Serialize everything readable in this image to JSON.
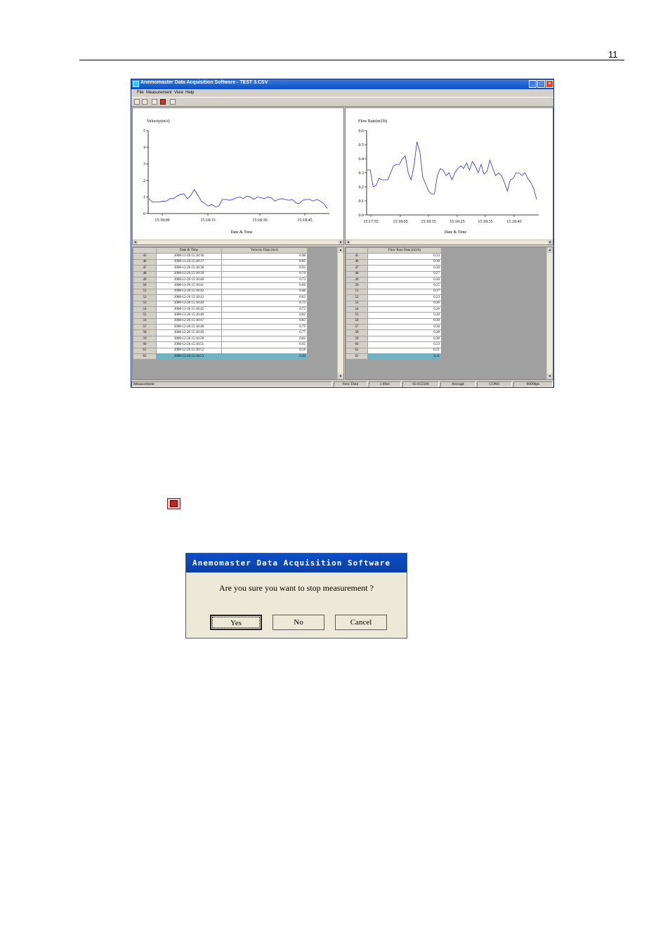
{
  "page": {
    "number": "11"
  },
  "window": {
    "title": "Anemomaster Data Acquisition Software - TEST 3.CSV",
    "buttons": {
      "min": "_",
      "max": "□",
      "close": "×"
    },
    "menu": [
      "File",
      "Measurement",
      "View",
      "Help"
    ],
    "toolbar_icons": [
      "new-icon",
      "save-icon",
      "print-icon",
      "stop-measurement-icon",
      "export-icon"
    ]
  },
  "charts": {
    "scroll_left": "◂",
    "scroll_right": "▸"
  },
  "chart_data": [
    {
      "type": "line",
      "ylabel": "Velocity(m/s)",
      "xlabel": "Date & Time",
      "ylim": [
        0,
        5
      ],
      "yticks": [
        "0",
        "1",
        "2",
        "3",
        "4",
        "5"
      ],
      "xticks": [
        "15:18:00",
        "15:18:15",
        "15:18:30",
        "15:18:45"
      ],
      "series": [
        {
          "color": "#2a2ad8",
          "values": [
            0.9,
            0.7,
            0.7,
            0.7,
            0.75,
            0.75,
            0.9,
            0.9,
            1.05,
            1.15,
            1.2,
            0.9,
            1.1,
            1.45,
            1.1,
            0.75,
            0.6,
            0.45,
            0.55,
            0.4,
            0.45,
            0.85,
            0.85,
            0.8,
            0.85,
            0.95,
            1.0,
            0.9,
            1.05,
            1.0,
            0.85,
            1.0,
            0.95,
            0.9,
            1.0,
            0.95,
            0.75,
            0.85,
            0.9,
            0.85,
            0.8,
            0.85,
            0.65,
            0.6,
            0.8,
            0.85,
            0.85,
            0.75,
            0.85,
            0.75,
            0.6,
            0.3
          ]
        }
      ]
    },
    {
      "type": "line",
      "ylabel": "Flow Rate(m3/h)",
      "xlabel": "Date & Time",
      "ylim": [
        0,
        0.6
      ],
      "yticks": [
        "0.0",
        "0.1",
        "0.2",
        "0.3",
        "0.4",
        "0.5",
        "0.6"
      ],
      "xticks": [
        "15:17:55",
        "15:18:05",
        "15:18:15",
        "15:18:25",
        "15:18:35",
        "15:18:45"
      ],
      "series": [
        {
          "color": "#2a2ad8",
          "values": [
            0.32,
            0.32,
            0.2,
            0.21,
            0.26,
            0.25,
            0.25,
            0.25,
            0.3,
            0.35,
            0.36,
            0.36,
            0.4,
            0.42,
            0.3,
            0.25,
            0.35,
            0.52,
            0.45,
            0.27,
            0.22,
            0.17,
            0.15,
            0.15,
            0.28,
            0.33,
            0.32,
            0.28,
            0.3,
            0.25,
            0.3,
            0.33,
            0.35,
            0.33,
            0.37,
            0.32,
            0.38,
            0.35,
            0.3,
            0.36,
            0.29,
            0.31,
            0.39,
            0.33,
            0.28,
            0.3,
            0.28,
            0.23,
            0.17,
            0.25,
            0.26,
            0.3,
            0.3,
            0.28,
            0.3,
            0.26,
            0.23,
            0.19,
            0.11
          ]
        }
      ]
    }
  ],
  "velocity_table": {
    "headers": [
      "Date & Time",
      "Velocity Data (m/s)"
    ],
    "rows": [
      {
        "n": "45",
        "dt": "2008-12-26 15:18:36",
        "v": "0.98"
      },
      {
        "n": "46",
        "dt": "2008-12-26 15:18:37",
        "v": "0.85"
      },
      {
        "n": "47",
        "dt": "2008-12-26 15:18:38",
        "v": "0.93"
      },
      {
        "n": "48",
        "dt": "2008-12-26 15:18:39",
        "v": "0.74"
      },
      {
        "n": "49",
        "dt": "2008-12-26 15:18:40",
        "v": "0.73"
      },
      {
        "n": "50",
        "dt": "2008-12-26 15:18:41",
        "v": "0.69"
      },
      {
        "n": "51",
        "dt": "2008-12-26 15:18:42",
        "v": "0.48"
      },
      {
        "n": "52",
        "dt": "2008-12-26 15:18:43",
        "v": "0.63"
      },
      {
        "n": "53",
        "dt": "2008-12-26 15:18:44",
        "v": "0.73"
      },
      {
        "n": "54",
        "dt": "2008-12-26 15:18:45",
        "v": "0.72"
      },
      {
        "n": "55",
        "dt": "2008-12-26 15:18:46",
        "v": "0.82"
      },
      {
        "n": "56",
        "dt": "2008-12-26 15:18:47",
        "v": "0.83"
      },
      {
        "n": "57",
        "dt": "2008-12-26 15:18:48",
        "v": "0.79"
      },
      {
        "n": "58",
        "dt": "2008-12-26 15:18:49",
        "v": "0.77"
      },
      {
        "n": "59",
        "dt": "2008-12-26 15:18:50",
        "v": "0.82"
      },
      {
        "n": "60",
        "dt": "2008-12-26 15:18:51",
        "v": "0.65"
      },
      {
        "n": "61",
        "dt": "2008-12-26 15:18:52",
        "v": "0.58"
      },
      {
        "n": "62",
        "dt": "2008-12-26 15:18:53",
        "v": "0.30",
        "selected": true
      }
    ]
  },
  "flow_table": {
    "headers": [
      "Flow Rate Data (m3/h)"
    ],
    "rows": [
      {
        "n": "45",
        "v": "0.33"
      },
      {
        "n": "46",
        "v": "0.30"
      },
      {
        "n": "47",
        "v": "0.30"
      },
      {
        "n": "48",
        "v": "0.27"
      },
      {
        "n": "49",
        "v": "0.26"
      },
      {
        "n": "50",
        "v": "0.25"
      },
      {
        "n": "51",
        "v": "0.17"
      },
      {
        "n": "52",
        "v": "0.23"
      },
      {
        "n": "53",
        "v": "0.26"
      },
      {
        "n": "54",
        "v": "0.26"
      },
      {
        "n": "55",
        "v": "0.30"
      },
      {
        "n": "56",
        "v": "0.30"
      },
      {
        "n": "57",
        "v": "0.28"
      },
      {
        "n": "58",
        "v": "0.28"
      },
      {
        "n": "59",
        "v": "0.30"
      },
      {
        "n": "60",
        "v": "0.23"
      },
      {
        "n": "61",
        "v": "0.21"
      },
      {
        "n": "62",
        "v": "0.11",
        "selected": true
      }
    ]
  },
  "scroll": {
    "up": "▴",
    "down": "▾"
  },
  "statusbar": [
    "Measurement",
    "New Data",
    "1.0Sec",
    "62.655500",
    "Average",
    "COM1",
    "9600bps"
  ],
  "dialog": {
    "title": "Anemomaster Data Acquisition Software",
    "message": "Are you sure you want to stop measurement ?",
    "buttons": [
      "Yes",
      "No",
      "Cancel"
    ]
  }
}
